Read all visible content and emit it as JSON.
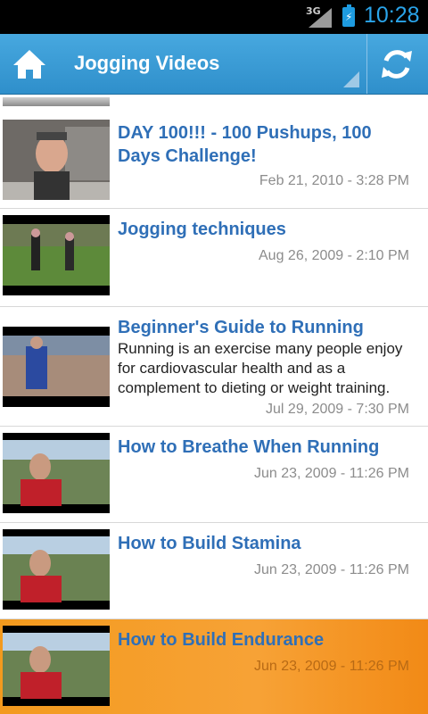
{
  "status_bar": {
    "network": "3G",
    "time": "10:28"
  },
  "action_bar": {
    "title": "Jogging Videos"
  },
  "videos": [
    {
      "title": "DAY 100!!! - 100 Pushups, 100 Days Challenge!",
      "description": "",
      "date": "Feb 21, 2010 - 3:28 PM"
    },
    {
      "title": "Jogging techniques",
      "description": "",
      "date": "Aug 26, 2009 - 2:10 PM"
    },
    {
      "title": "Beginner's Guide to Running",
      "description": "Running is an exercise many people enjoy for cardiovascular health and as a complement to dieting or weight training.",
      "date": "Jul 29, 2009 - 7:30 PM"
    },
    {
      "title": "How to Breathe When Running",
      "description": "",
      "date": "Jun 23, 2009 - 11:26 PM"
    },
    {
      "title": "How to Build Stamina",
      "description": "",
      "date": "Jun 23, 2009 - 11:26 PM"
    },
    {
      "title": "How to Build Endurance",
      "description": "",
      "date": "Jun 23, 2009 - 11:26 PM"
    }
  ],
  "colors": {
    "action_bar": "#3a9ad6",
    "link_title": "#2f6fb7",
    "selected_row": "#f7a236",
    "status_time": "#2aa4ea"
  },
  "icons": {
    "home": "home-icon",
    "refresh": "refresh-icon",
    "battery": "battery-charging-icon",
    "signal": "signal-icon"
  }
}
